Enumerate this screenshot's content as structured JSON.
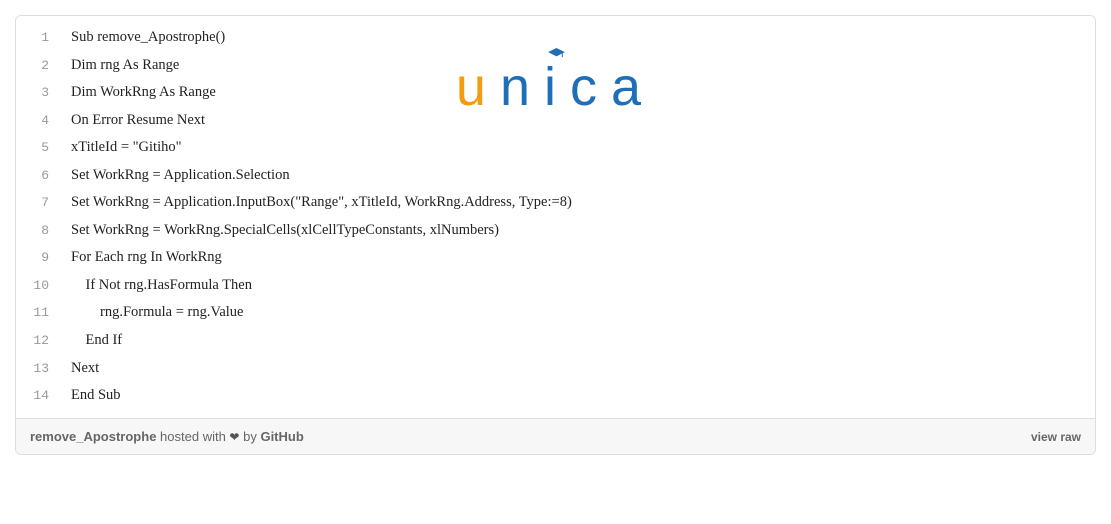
{
  "watermark": {
    "u": "u",
    "n": "n",
    "i": "i",
    "c": "c",
    "a": "a"
  },
  "code": {
    "lines": [
      {
        "num": "1",
        "text": "Sub remove_Apostrophe()"
      },
      {
        "num": "2",
        "text": "Dim rng As Range"
      },
      {
        "num": "3",
        "text": "Dim WorkRng As Range"
      },
      {
        "num": "4",
        "text": "On Error Resume Next"
      },
      {
        "num": "5",
        "text": "xTitleId = \"Gitiho\""
      },
      {
        "num": "6",
        "text": "Set WorkRng = Application.Selection"
      },
      {
        "num": "7",
        "text": "Set WorkRng = Application.InputBox(\"Range\", xTitleId, WorkRng.Address, Type:=8)"
      },
      {
        "num": "8",
        "text": "Set WorkRng = WorkRng.SpecialCells(xlCellTypeConstants, xlNumbers)"
      },
      {
        "num": "9",
        "text": "For Each rng In WorkRng"
      },
      {
        "num": "10",
        "text": "    If Not rng.HasFormula Then"
      },
      {
        "num": "11",
        "text": "        rng.Formula = rng.Value"
      },
      {
        "num": "12",
        "text": "    End If"
      },
      {
        "num": "13",
        "text": "Next"
      },
      {
        "num": "14",
        "text": "End Sub"
      }
    ]
  },
  "footer": {
    "filename": "remove_Apostrophe",
    "hosted_prefix": " hosted with ",
    "heart": "❤",
    "by": " by ",
    "github": "GitHub",
    "view_raw": "view raw"
  }
}
